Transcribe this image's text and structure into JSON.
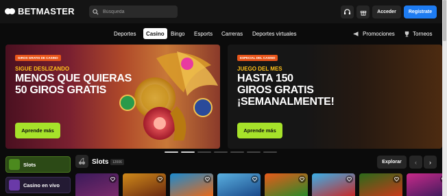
{
  "header": {
    "logo_text": "BETMASTER",
    "search_placeholder": "Búsqueda",
    "acceder_label": "Acceder",
    "register_label": "Regístrate"
  },
  "nav": {
    "items": [
      "Deportes",
      "Casino",
      "Bingo",
      "Esports",
      "Carreras",
      "Deportes virtuales"
    ],
    "active": "Casino",
    "promociones_label": "Promociones",
    "torneos_label": "Torneos"
  },
  "banners": [
    {
      "tag": "GIROS GRATIS DE CASINO",
      "kicker": "SIGUE DESLIZANDO",
      "headline_lines": [
        "MENOS QUE QUIERAS",
        "50 GIROS GRATIS"
      ],
      "cta": "Aprende más"
    },
    {
      "tag": "ESPECIAL DEL CASINO",
      "kicker": "JUEGO DEL MES",
      "headline_lines": [
        "HASTA 150",
        "GIROS GRATIS",
        "¡SEMANALMENTE!"
      ],
      "cta": "Aprende más"
    }
  ],
  "carousel": {
    "dot_count": 7,
    "active_index": 1
  },
  "categories": [
    {
      "label": "Slots",
      "color": "#4c8a1e"
    },
    {
      "label": "Casino en vivo",
      "color": "#6a3aa8"
    }
  ],
  "slots_section": {
    "title": "Slots",
    "count": "12006",
    "explore_label": "Explorar"
  },
  "games": [
    {
      "colors": [
        "#3a1a5a",
        "#7a2a6a"
      ]
    },
    {
      "colors": [
        "#d08a1a",
        "#6a2a10"
      ]
    },
    {
      "colors": [
        "#1a8ad0",
        "#e86a1a"
      ]
    },
    {
      "colors": [
        "#5ab0e0",
        "#1a4a8a"
      ]
    },
    {
      "colors": [
        "#e85a1a",
        "#2a8a2a"
      ]
    },
    {
      "colors": [
        "#3ab0e8",
        "#c82a2a"
      ]
    },
    {
      "colors": [
        "#2a6a1a",
        "#c83a1a"
      ]
    },
    {
      "colors": [
        "#c82a8a",
        "#3a1a5a"
      ]
    }
  ],
  "colors": {
    "accent_blue": "#1e7cf2",
    "cta_green": "#a6e22a",
    "kicker_yellow": "#ffc21a",
    "tag_orange": "#e8551a"
  }
}
